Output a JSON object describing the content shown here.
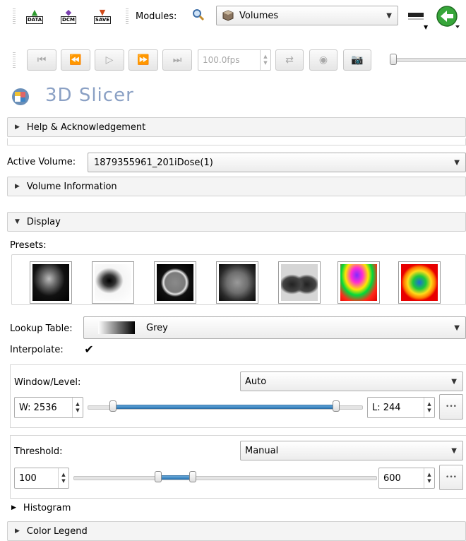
{
  "toolbar": {
    "data_label": "DATA",
    "dcm_label": "DCM",
    "save_label": "SAVE",
    "modules_label": "Modules:",
    "module_selected": "Volumes",
    "fps_value": "100.0fps"
  },
  "app": {
    "title": "3D Slicer"
  },
  "sections": {
    "help": "Help & Acknowledgement",
    "volume_info": "Volume Information",
    "display": "Display",
    "histogram": "Histogram",
    "color_legend": "Color Legend"
  },
  "active_volume": {
    "label": "Active Volume:",
    "value": "1879355961_201iDose(1)"
  },
  "display": {
    "presets_label": "Presets:",
    "lookup_label": "Lookup Table:",
    "lookup_value": "Grey",
    "interpolate_label": "Interpolate:",
    "interpolate_check": "✔"
  },
  "window_level": {
    "label": "Window/Level:",
    "mode": "Auto",
    "w_value": "W: 2536",
    "l_value": "L: 244",
    "range_fraction": [
      0.0,
      1.0
    ]
  },
  "threshold": {
    "label": "Threshold:",
    "mode": "Manual",
    "min_value": "100",
    "max_value": "600",
    "range_fraction": [
      0.28,
      0.4
    ]
  },
  "colors": {
    "accent": "#2f7ab8",
    "section_bg": "#f4f4f4"
  }
}
